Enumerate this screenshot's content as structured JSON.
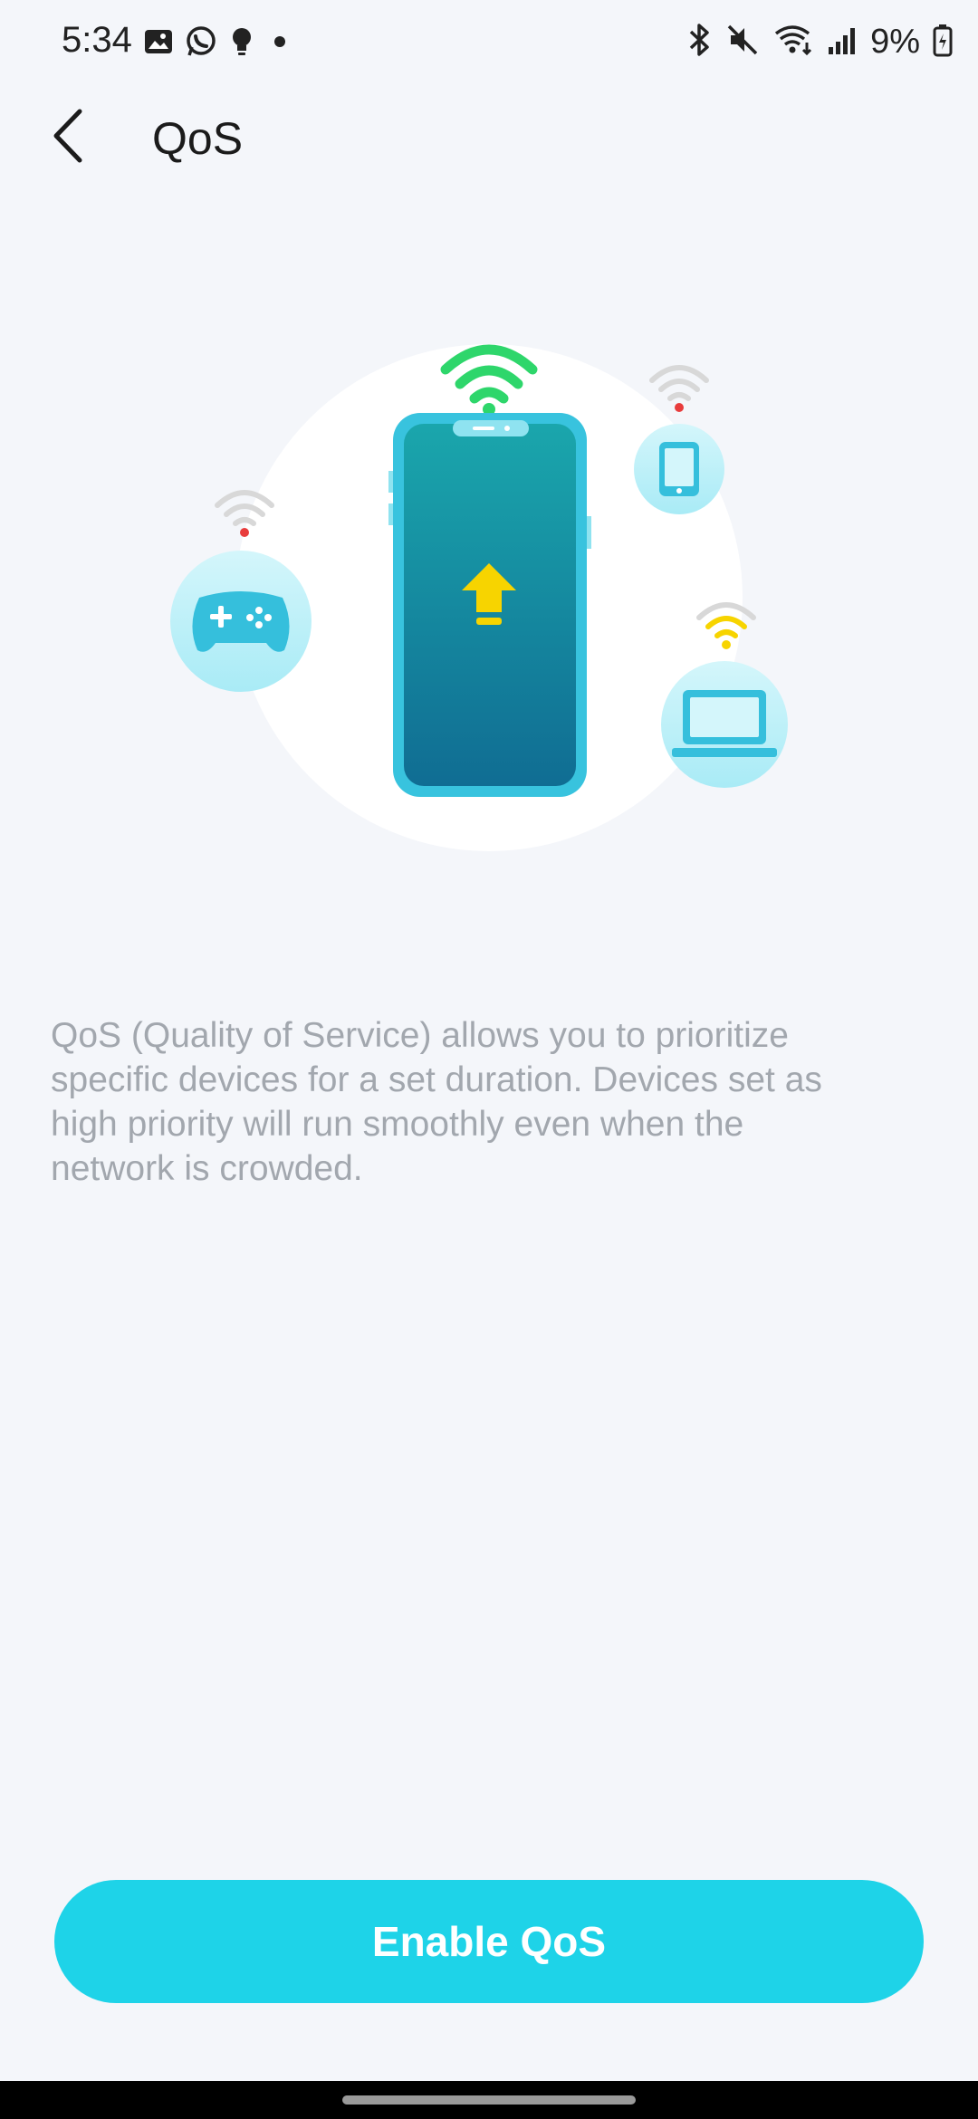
{
  "status_bar": {
    "time": "5:34",
    "battery": "9%",
    "left_icons": [
      "gallery-icon",
      "whatsapp-icon",
      "bulb-icon",
      "dot-icon"
    ],
    "right_icons": [
      "bluetooth-icon",
      "mute-icon",
      "wifi-icon",
      "signal-icon",
      "battery-icon"
    ]
  },
  "app_bar": {
    "title": "QoS",
    "back_icon": "chevron-left-icon"
  },
  "illustration": {
    "center_icon": "phone-upload-icon",
    "devices": [
      "gamepad-icon",
      "tablet-icon",
      "laptop-icon"
    ],
    "colors": {
      "wifi_green": "#2ed66b",
      "phone": "#1aa3ad",
      "arrow": "#f7d400",
      "device_bubble": "#bdf0f8"
    }
  },
  "description": "QoS (Quality of Service) allows you to prioritize specific devices for a set duration. Devices set as high priority will run smoothly even when the network is crowded.",
  "enable_button": {
    "label": "Enable QoS",
    "color": "#1ed3e8"
  }
}
